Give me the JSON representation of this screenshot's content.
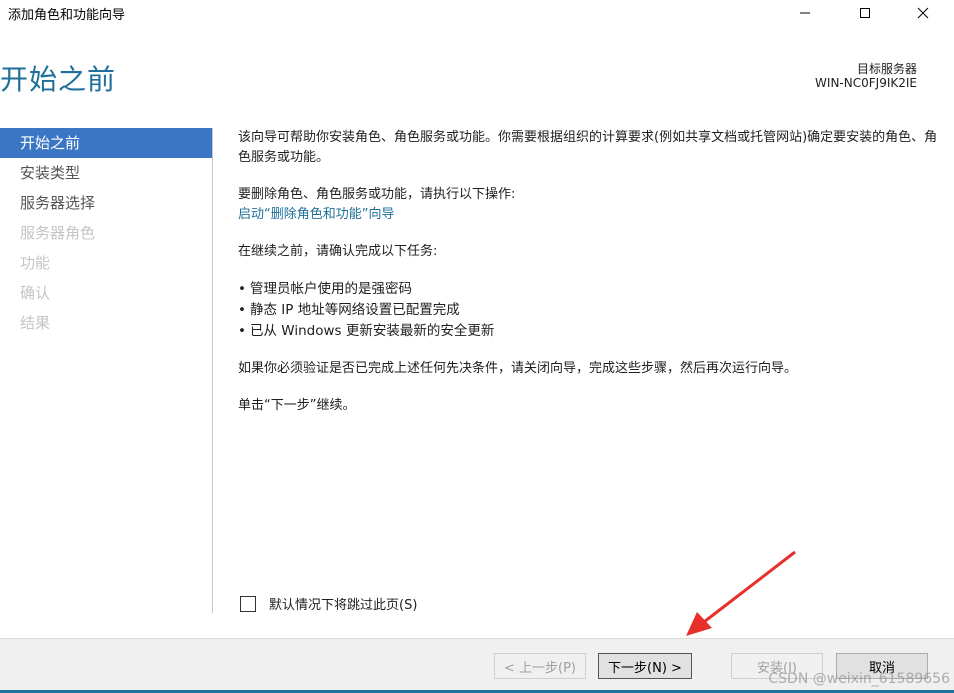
{
  "window": {
    "title": "添加角色和功能向导",
    "controls": {
      "minimize": "minimize-icon",
      "maximize": "maximize-icon",
      "close": "close-icon"
    }
  },
  "header": {
    "page_title": "开始之前",
    "server_label": "目标服务器",
    "server_name": "WIN-NC0FJ9IK2IE"
  },
  "nav": {
    "items": [
      {
        "label": "开始之前",
        "state": "active"
      },
      {
        "label": "安装类型",
        "state": "enabled"
      },
      {
        "label": "服务器选择",
        "state": "enabled"
      },
      {
        "label": "服务器角色",
        "state": "disabled"
      },
      {
        "label": "功能",
        "state": "disabled"
      },
      {
        "label": "确认",
        "state": "disabled"
      },
      {
        "label": "结果",
        "state": "disabled"
      }
    ]
  },
  "content": {
    "intro": "该向导可帮助你安装角色、角色服务或功能。你需要根据组织的计算要求(例如共享文档或托管网站)确定要安装的角色、角色服务或功能。",
    "remove_text": "要删除角色、角色服务或功能，请执行以下操作:",
    "remove_link": "启动“删除角色和功能”向导",
    "before_text": "在继续之前，请确认完成以下任务:",
    "tasks": [
      "管理员帐户使用的是强密码",
      "静态 IP 地址等网络设置已配置完成",
      "已从 Windows 更新安装最新的安全更新"
    ],
    "prereq_text": "如果你必须验证是否已完成上述任何先决条件，请关闭向导，完成这些步骤，然后再次运行向导。",
    "continue_text": "单击“下一步”继续。"
  },
  "skip": {
    "label": "默认情况下将跳过此页(S)",
    "checked": false
  },
  "buttons": {
    "prev": "< 上一步(P)",
    "next": "下一步(N) >",
    "install": "安装(I)",
    "cancel": "取消"
  },
  "watermark": "CSDN @weixin_61589656",
  "colors": {
    "accent": "#3b76c4",
    "title": "#1e6f9a",
    "annotation_arrow": "#e8302a"
  }
}
